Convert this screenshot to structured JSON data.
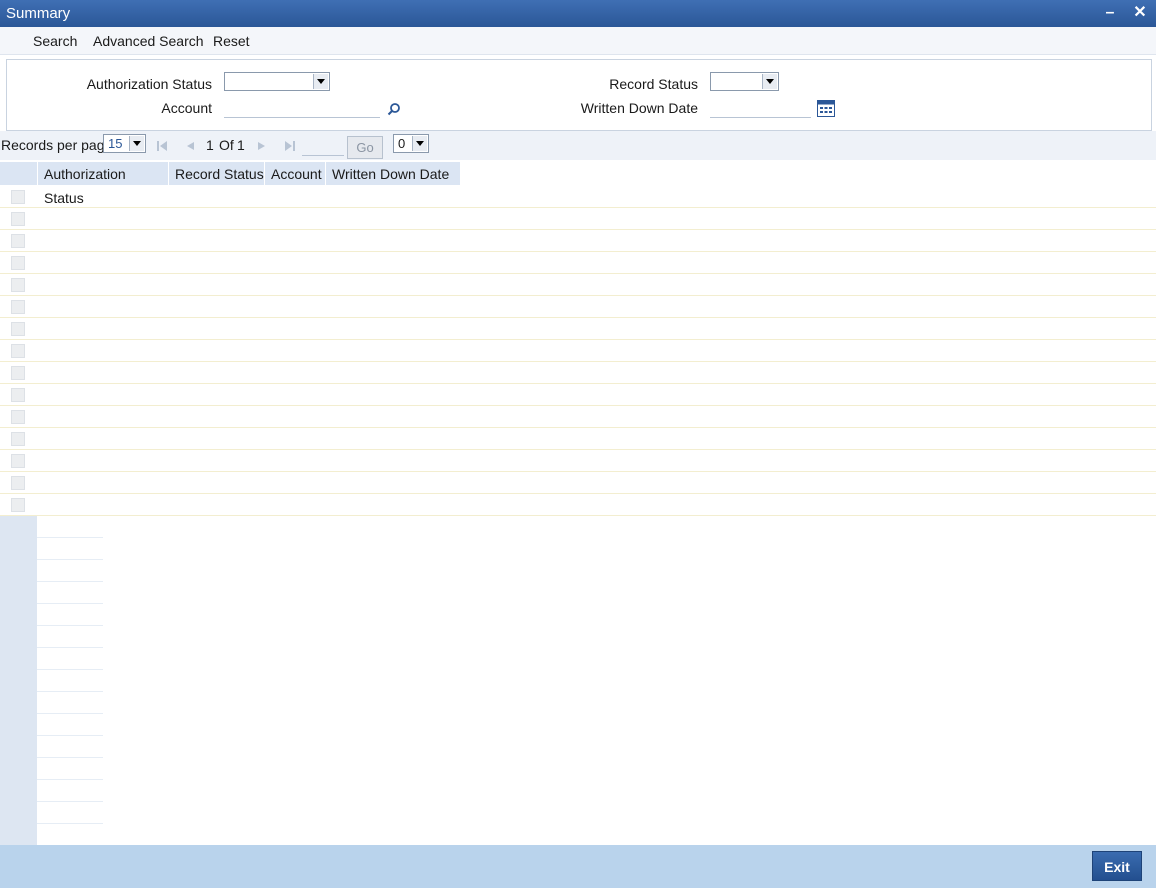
{
  "window": {
    "title": "Summary"
  },
  "menu": {
    "search": "Search",
    "advanced_search": "Advanced Search",
    "reset": "Reset"
  },
  "criteria": {
    "authorization_status_label": "Authorization Status",
    "authorization_status_value": "",
    "account_label": "Account",
    "account_value": "",
    "record_status_label": "Record Status",
    "record_status_value": "",
    "written_down_date_label": "Written Down Date",
    "written_down_date_value": ""
  },
  "pager": {
    "records_per_page_label": "Records per page",
    "records_per_page": "15",
    "current_page": "1",
    "of_label": "Of",
    "total_pages": "1",
    "go_label": "Go",
    "jump_value": "0"
  },
  "grid": {
    "columns": [
      "Authorization Status",
      "Record Status",
      "Account",
      "Written Down Date"
    ]
  },
  "footer": {
    "exit_label": "Exit"
  },
  "colors": {
    "title_bar": "#2b5797",
    "footer": "#b9d3ec",
    "header": "#dbe5f3"
  }
}
